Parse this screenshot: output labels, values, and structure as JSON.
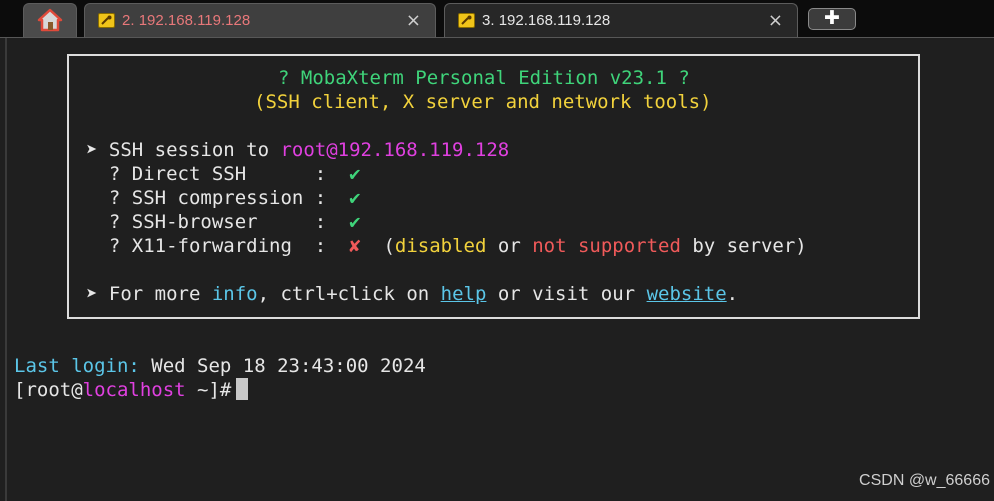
{
  "tabs": [
    {
      "number": "2.",
      "host": "192.168.119.128",
      "state": "inactive"
    },
    {
      "number": "3.",
      "host": "192.168.119.128",
      "state": "active"
    }
  ],
  "icons": {
    "home": "home-icon",
    "session": "key-icon",
    "close": "×",
    "new_tab": "✚"
  },
  "welcome": {
    "title": "? MobaXterm Personal Edition v23.1 ?",
    "subtitle": "(SSH client, X server and network tools)",
    "session_prefix": "➤ SSH session to ",
    "session_target": "root@192.168.119.128",
    "features": [
      {
        "label": "? Direct SSH      :",
        "status": "✔"
      },
      {
        "label": "? SSH compression :",
        "status": "✔"
      },
      {
        "label": "? SSH-browser     :",
        "status": "✔"
      },
      {
        "label": "? X11-forwarding  :",
        "status": "✘"
      }
    ],
    "x11_note": {
      "open": "(",
      "disabled": "disabled",
      "or": " or ",
      "not_supported": "not supported",
      "tail": " by server)"
    },
    "more": {
      "prefix": "➤ For more ",
      "info": "info",
      "middle": ", ctrl+click on ",
      "help": "help",
      "middle2": " or visit our ",
      "website": "website",
      "end": "."
    }
  },
  "terminal": {
    "last_login_label": "Last login:",
    "last_login_value": " Wed Sep 18 23:43:00 2024",
    "prompt_open": "[root@",
    "prompt_host": "localhost",
    "prompt_close": " ~]#"
  },
  "watermark": "CSDN @w_66666",
  "colors": {
    "green": "#3fd47a",
    "yellow": "#f2d23c",
    "magenta": "#e040e0",
    "red": "#f05a5a",
    "cyan": "#5bc6e8",
    "background": "#1f1f1f"
  }
}
